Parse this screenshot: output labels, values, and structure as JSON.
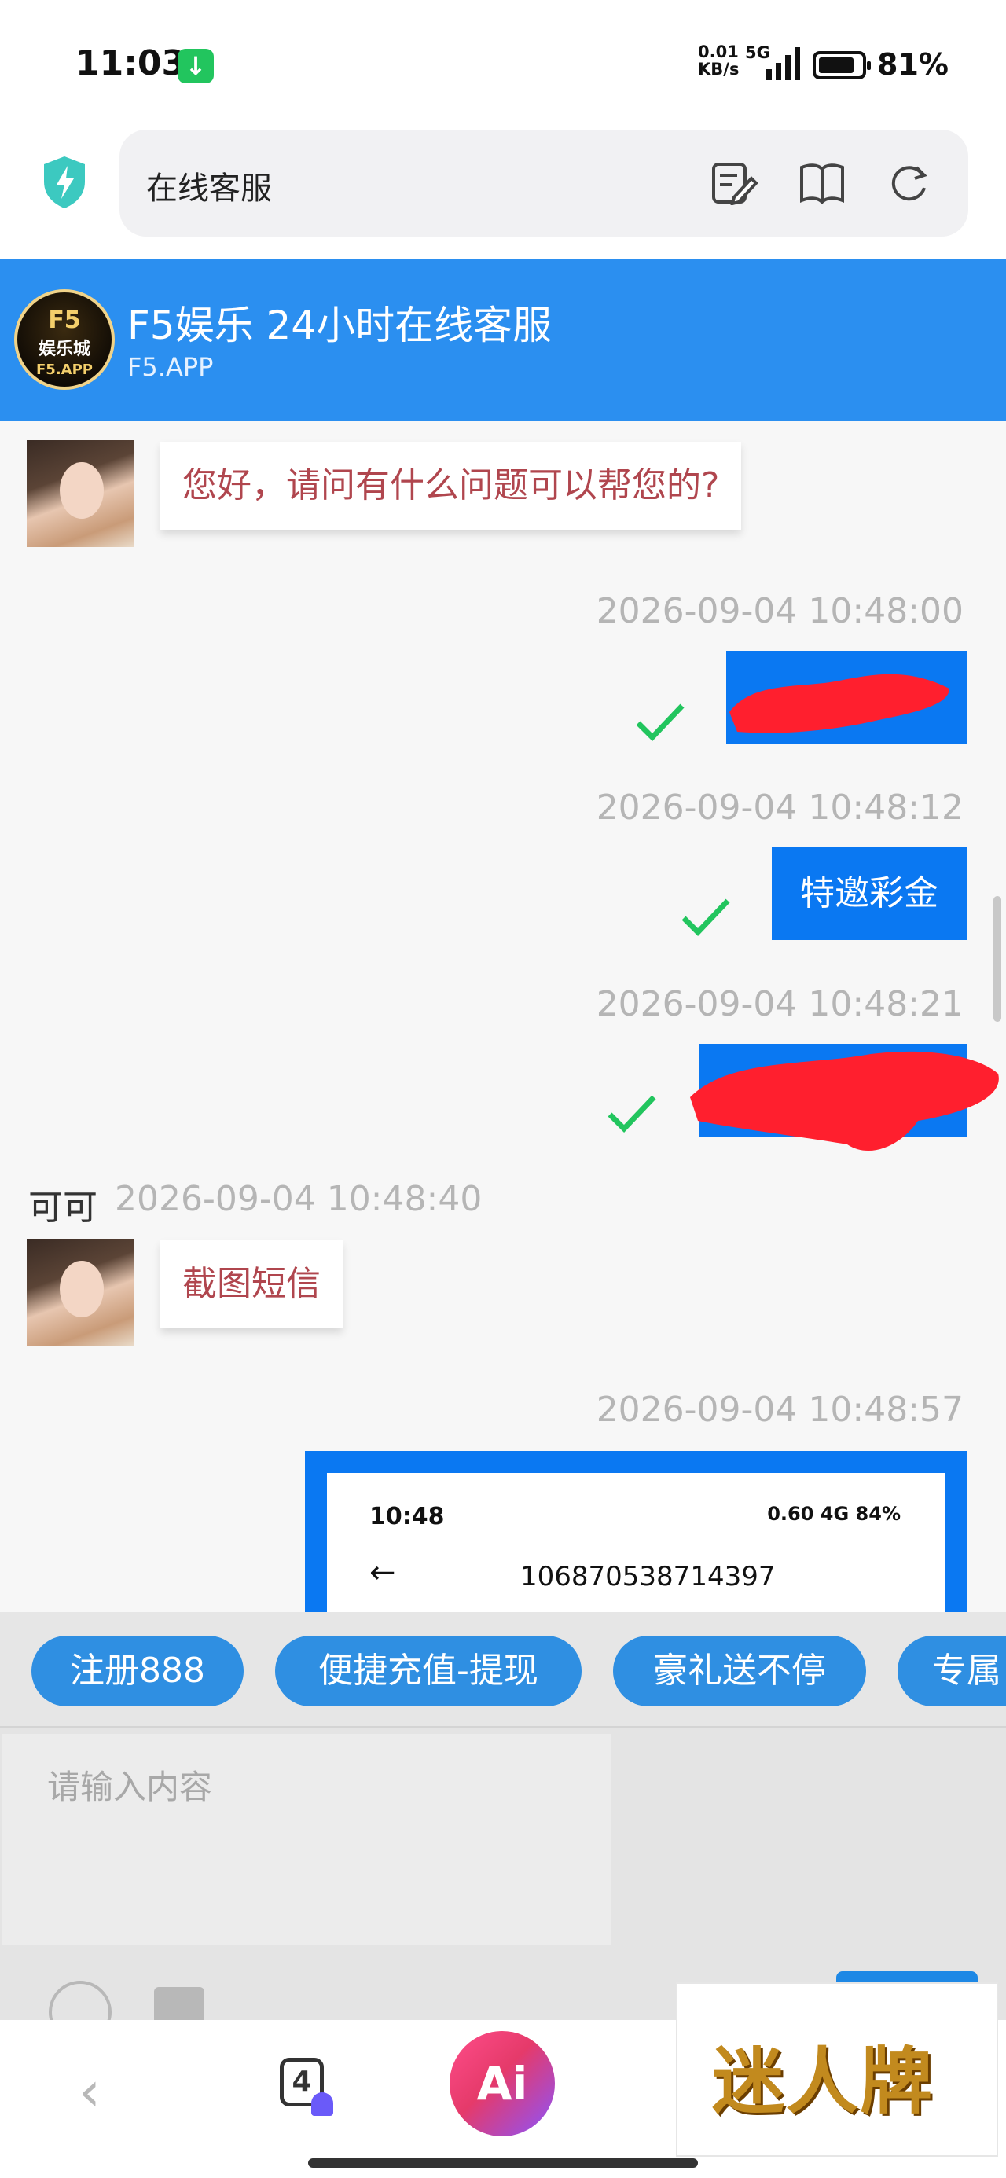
{
  "status_bar": {
    "time": "11:03",
    "network_speed_value": "0.01",
    "network_speed_unit": "KB/s",
    "network_type": "5G",
    "battery_percent": "81%",
    "battery_level": 0.81
  },
  "browser": {
    "url_title": "在线客服",
    "icons": [
      "shield-lightning-icon",
      "edit-note-icon",
      "book-icon",
      "refresh-icon"
    ]
  },
  "chat_header": {
    "logo_line1": "F5",
    "logo_line2": "娱乐城",
    "logo_line3": "F5.APP",
    "title": "F5娱乐 24小时在线客服",
    "subtitle": "F5.APP",
    "color": "#2b8ff0"
  },
  "messages": {
    "m1_text": "您好，请问有什么问题可以帮您的?",
    "m2_time": "2026-09-04 10:48:00",
    "m3_time": "2026-09-04 10:48:12",
    "m3_text": "特邀彩金",
    "m4_time": "2026-09-04 10:48:21",
    "m5_sender": "可可",
    "m5_time": "2026-09-04 10:48:40",
    "m5_text": "截图短信",
    "m6_time": "2026-09-04 10:48:57",
    "m6_shot_time": "10:48",
    "m6_shot_status": "0.60 4G 84%",
    "m6_shot_back": "←",
    "m6_shot_number": "106870538714397"
  },
  "quick_replies": {
    "c1": "注册888",
    "c2": "便捷充值-提现",
    "c3": "豪礼送不停",
    "c4": "专属"
  },
  "input": {
    "placeholder": "请输入内容"
  },
  "bottom_nav": {
    "back": "‹",
    "tab_count": "4",
    "ai_label": "Ai"
  },
  "watermark": {
    "text": "迷人牌"
  },
  "colors": {
    "accent": "#0a78f2",
    "incoming_text": "#b0464e",
    "check": "#22c55e",
    "redaction": "#ff1f2e"
  }
}
